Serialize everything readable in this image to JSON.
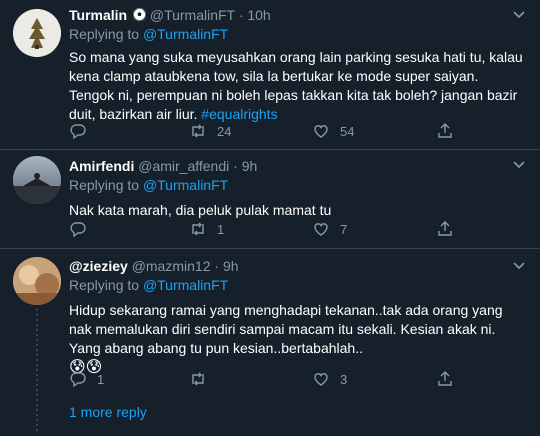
{
  "tweets": [
    {
      "name": "Turmalin",
      "name_icon": "soccer-ball-icon",
      "handle": "@TurmalinFT",
      "time": "10h",
      "replying_prefix": "Replying to ",
      "replying_to": "@TurmalinFT",
      "text": "So mana yang suka meyusahkan orang lain parking sesuka hati tu, kalau kena clamp ataubkena tow, sila la bertukar ke mode super saiyan. Tengok ni, perempuan ni boleh lepas takkan kita tak boleh? jangan bazir duit, bazirkan air liur.",
      "hashtag": "#equalrights",
      "reply_count": "",
      "retweet_count": "24",
      "like_count": "54"
    },
    {
      "name": "Amirfendi",
      "handle": "@amir_affendi",
      "time": "9h",
      "replying_prefix": "Replying to ",
      "replying_to": "@TurmalinFT",
      "text": "Nak kata marah, dia peluk pulak mamat tu",
      "reply_count": "",
      "retweet_count": "1",
      "like_count": "7"
    },
    {
      "name": "@zieziey",
      "handle": "@mazmin12",
      "time": "9h",
      "replying_prefix": "Replying to ",
      "replying_to": "@TurmalinFT",
      "text": "Hidup sekarang ramai yang menghadapi tekanan..tak ada orang yang nak memalukan diri sendiri sampai macam itu sekali. Kesian akak ni. Yang abang abang tu pun kesian..bertabahlah..",
      "emoji": "😰😰",
      "reply_count": "1",
      "retweet_count": "",
      "like_count": "3"
    }
  ],
  "separator": " · ",
  "more_replies": "1 more reply",
  "colors": {
    "background": "#15202b",
    "border": "#38444d",
    "muted": "#8899a6",
    "link": "#1da1f2"
  }
}
